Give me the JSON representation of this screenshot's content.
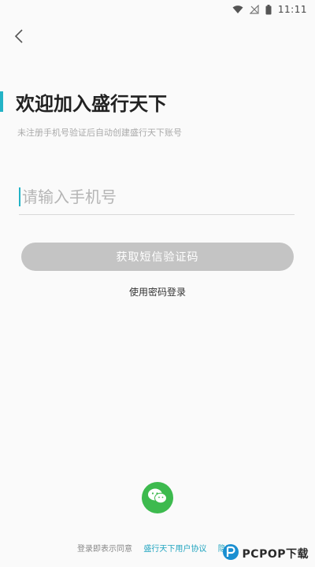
{
  "status_bar": {
    "time": "11:11",
    "icons": [
      "wifi-icon",
      "no-signal-icon",
      "battery-icon"
    ]
  },
  "header": {
    "back_icon": "chevron-left-icon"
  },
  "main": {
    "title": "欢迎加入盛行天下",
    "subtitle": "未注册手机号验证后自动创建盛行天下账号",
    "phone_input": {
      "value": "",
      "placeholder": "请输入手机号"
    },
    "sms_button_label": "获取短信验证码",
    "password_login_label": "使用密码登录"
  },
  "footer": {
    "wechat_icon": "wechat-icon",
    "agreement_prefix": "登录即表示同意",
    "agreement_link_1": "盛行天下用户协议",
    "agreement_link_2": "隐私"
  },
  "watermark": {
    "text": "PCPOP下载"
  },
  "colors": {
    "accent": "#23b3c6",
    "button_disabled": "#c4c4c4",
    "wechat_green": "#3dba4e",
    "link": "#23a5c0"
  }
}
